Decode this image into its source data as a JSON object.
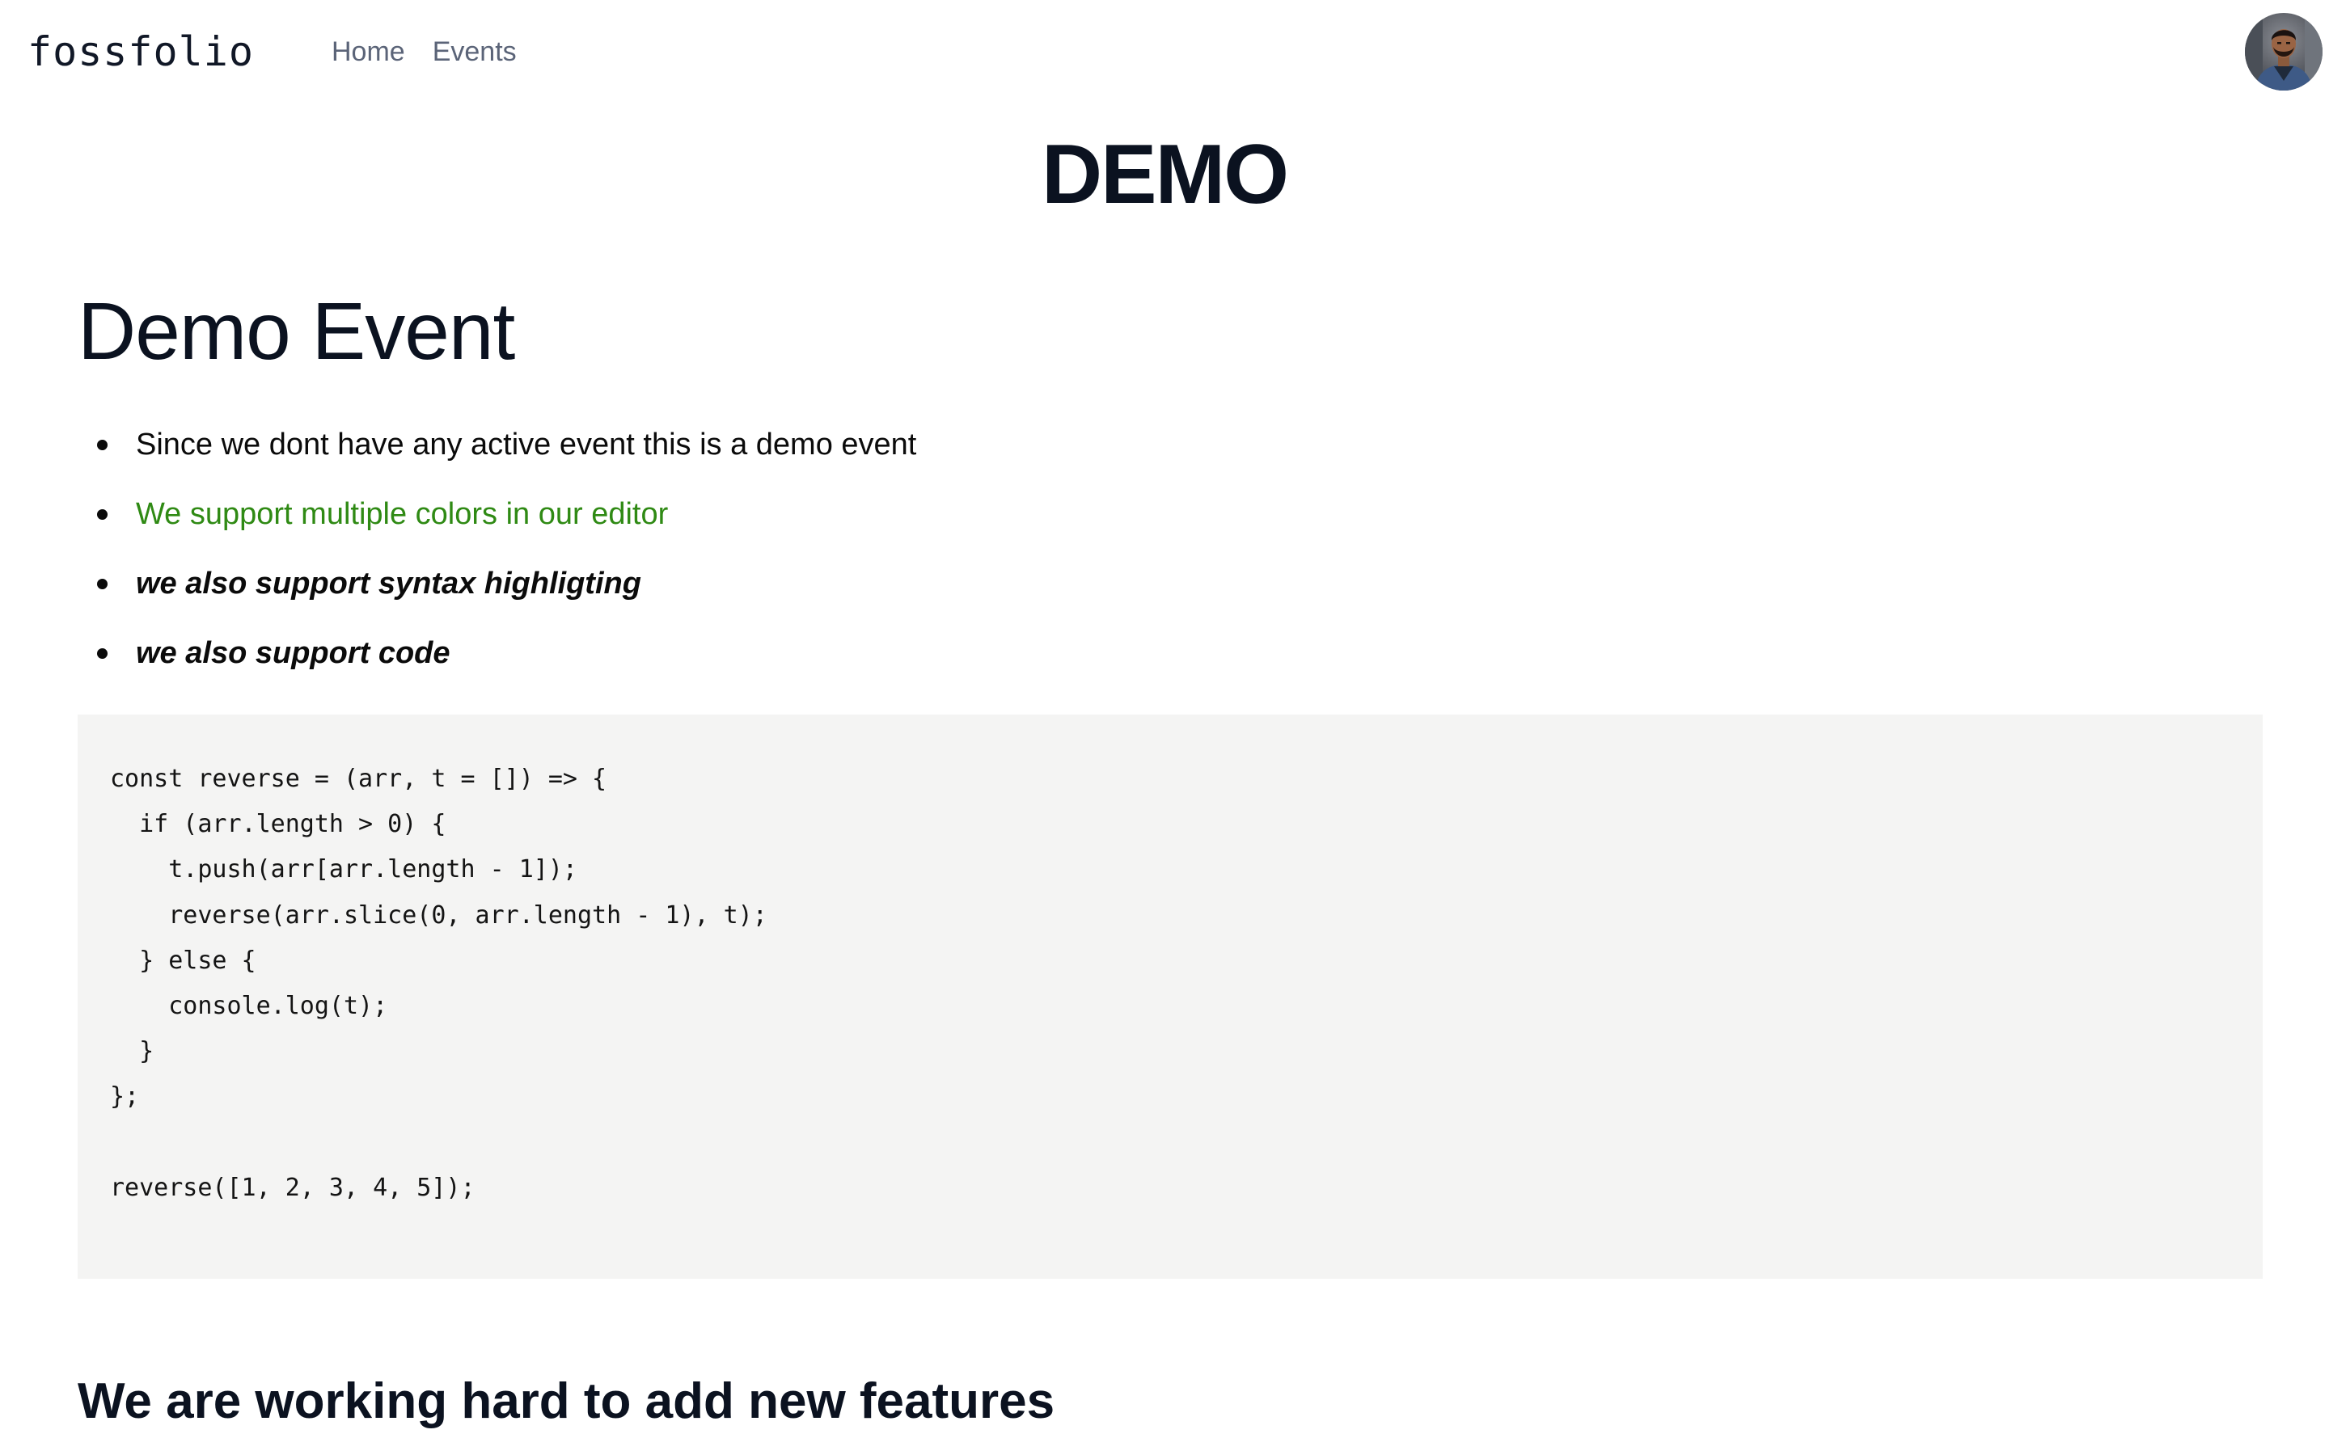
{
  "header": {
    "logo": "fossfolio",
    "nav": [
      {
        "label": "Home"
      },
      {
        "label": "Events"
      }
    ]
  },
  "page": {
    "title": "DEMO"
  },
  "event": {
    "title": "Demo Event",
    "bullets": [
      {
        "text": "Since we dont have any active event this is a demo event",
        "style": "plain"
      },
      {
        "text": "We support multiple colors in our editor",
        "style": "green"
      },
      {
        "text": "we also support syntax highligting",
        "style": "bold-italic"
      },
      {
        "text": "we also support code",
        "style": "bold-italic"
      }
    ],
    "code": [
      "const reverse = (arr, t = []) => {",
      "  if (arr.length > 0) {",
      "    t.push(arr[arr.length - 1]);",
      "    reverse(arr.slice(0, arr.length - 1), t);",
      "  } else {",
      "    console.log(t);",
      "  }",
      "};",
      "",
      "reverse([1, 2, 3, 4, 5]);"
    ],
    "footer_heading": "We are working hard to add new features"
  },
  "colors": {
    "accent_green": "#2f8a14",
    "code_background": "#f4f4f3",
    "nav_text": "#5b6478"
  },
  "icons": {
    "avatar": "user-avatar-photo"
  }
}
